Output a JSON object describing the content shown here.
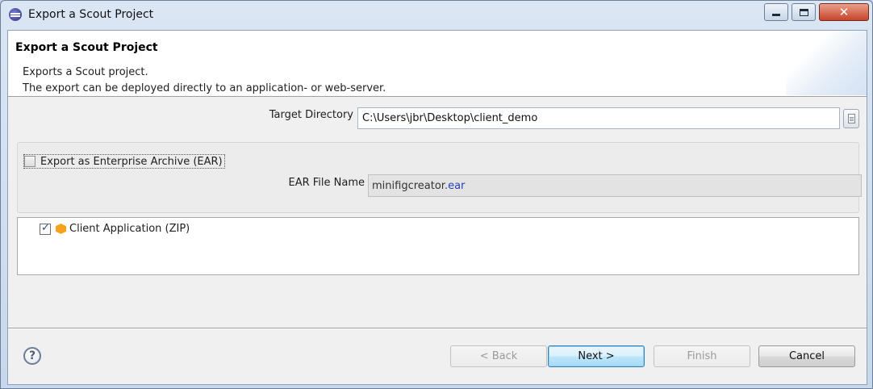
{
  "window": {
    "title": "Export a Scout Project",
    "close_glyph": "✕"
  },
  "header": {
    "title": "Export a Scout Project",
    "description_line1": "Exports a Scout project.",
    "description_line2": "The export can be deployed directly to an application- or web-server."
  },
  "target": {
    "label": "Target Directory",
    "value": "C:\\Users\\jbr\\Desktop\\client_demo"
  },
  "ear": {
    "checkbox_label": "Export as Enterprise Archive (EAR)",
    "checked": false,
    "file_name_label": "EAR File Name",
    "file_name_base": "minifigcreator",
    "file_name_ext": ".ear"
  },
  "tree": {
    "items": [
      {
        "label": "Client Application (ZIP)",
        "checked": true,
        "icon": "zip-package-icon"
      }
    ]
  },
  "buttons": {
    "help": "?",
    "back": "< Back",
    "next": "Next >",
    "finish": "Finish",
    "cancel": "Cancel"
  }
}
